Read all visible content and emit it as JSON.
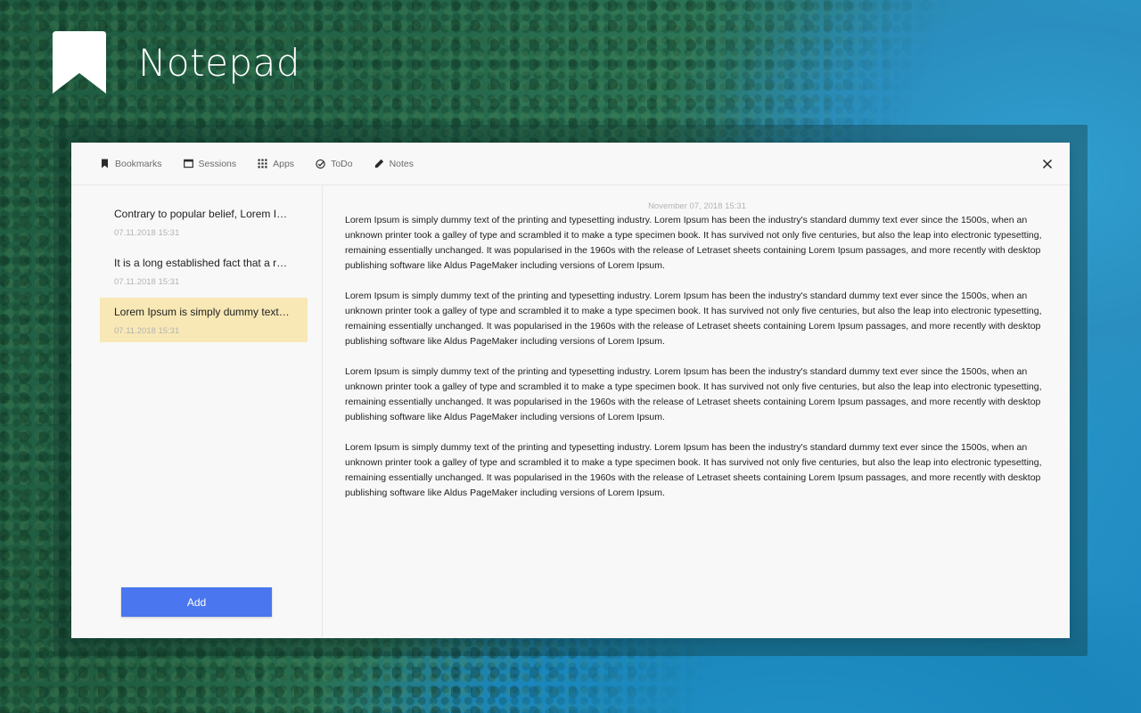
{
  "app": {
    "title": "Notepad",
    "logo_icon": "bookmark-logo-icon"
  },
  "nav": {
    "items": [
      {
        "label": "Bookmarks",
        "icon": "bookmark-icon"
      },
      {
        "label": "Sessions",
        "icon": "window-icon"
      },
      {
        "label": "Apps",
        "icon": "grid-icon"
      },
      {
        "label": "ToDo",
        "icon": "check-circle-icon"
      },
      {
        "label": "Notes",
        "icon": "pencil-icon"
      }
    ],
    "close_icon": "close-icon"
  },
  "notes": [
    {
      "title": "Contrary to popular belief, Lorem Ipsum is not simply random text.",
      "date": "07.11.2018 15:31",
      "active": false
    },
    {
      "title": "It is a long established fact that a reader will be distracted.",
      "date": "07.11.2018 15:31",
      "active": false
    },
    {
      "title": "Lorem Ipsum is simply dummy text of the printing.",
      "date": "07.11.2018 15:31",
      "active": true
    }
  ],
  "add_label": "Add",
  "editor": {
    "date": "November 07, 2018 15:31",
    "paragraphs": [
      "Lorem Ipsum is simply dummy text of the printing and typesetting industry. Lorem Ipsum has been the industry's standard dummy text ever since the 1500s, when an unknown printer took a galley of type and scrambled it to make a type specimen book. It has survived not only five centuries, but also the leap into electronic typesetting, remaining essentially unchanged. It was popularised in the 1960s with the release of Letraset sheets containing Lorem Ipsum passages, and more recently with desktop publishing software like Aldus PageMaker including versions of Lorem Ipsum.",
      "Lorem Ipsum is simply dummy text of the printing and typesetting industry. Lorem Ipsum has been the industry's standard dummy text ever since the 1500s, when an unknown printer took a galley of type and scrambled it to make a type specimen book. It has survived not only five centuries, but also the leap into electronic typesetting, remaining essentially unchanged. It was popularised in the 1960s with the release of Letraset sheets containing Lorem Ipsum passages, and more recently with desktop publishing software like Aldus PageMaker including versions of Lorem Ipsum.",
      "Lorem Ipsum is simply dummy text of the printing and typesetting industry. Lorem Ipsum has been the industry's standard dummy text ever since the 1500s, when an unknown printer took a galley of type and scrambled it to make a type specimen book. It has survived not only five centuries, but also the leap into electronic typesetting, remaining essentially unchanged. It was popularised in the 1960s with the release of Letraset sheets containing Lorem Ipsum passages, and more recently with desktop publishing software like Aldus PageMaker including versions of Lorem Ipsum.",
      "Lorem Ipsum is simply dummy text of the printing and typesetting industry. Lorem Ipsum has been the industry's standard dummy text ever since the 1500s, when an unknown printer took a galley of type and scrambled it to make a type specimen book. It has survived not only five centuries, but also the leap into electronic typesetting, remaining essentially unchanged. It was popularised in the 1960s with the release of Letraset sheets containing Lorem Ipsum passages, and more recently with desktop publishing software like Aldus PageMaker including versions of Lorem Ipsum."
    ]
  },
  "colors": {
    "accent": "#4a77f0",
    "active_note": "#f8e8b5"
  }
}
